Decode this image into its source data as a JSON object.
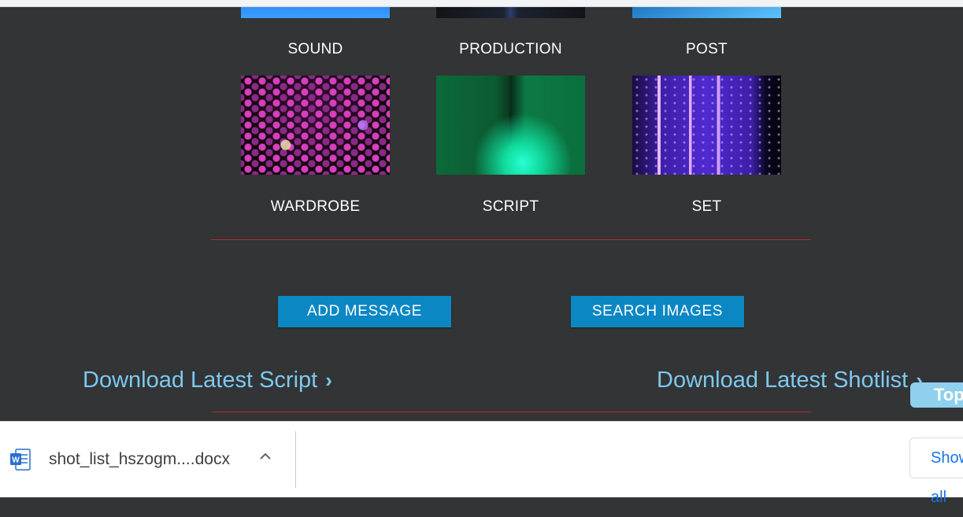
{
  "gallery": {
    "top_row": [
      {
        "label": "SOUND",
        "image": "blue-laser-photo"
      },
      {
        "label": "PRODUCTION",
        "image": "dark-stage-photo"
      },
      {
        "label": "POST",
        "image": "blue-light-beams-photo"
      }
    ],
    "bottom_row": [
      {
        "label": "WARDROBE",
        "image": "magenta-bokeh-photo"
      },
      {
        "label": "SCRIPT",
        "image": "green-light-photo"
      },
      {
        "label": "SET",
        "image": "purple-light-strips-photo"
      }
    ]
  },
  "actions": {
    "add_message": "ADD MESSAGE",
    "search_images": "SEARCH IMAGES"
  },
  "downloads": {
    "script_link": "Download Latest Script",
    "shotlist_link": "Download Latest Shotlist",
    "chevron": "›"
  },
  "top_button": "Top",
  "download_bar": {
    "file_name": "shot_list_hszogm....docx",
    "file_icon": "word-doc-icon",
    "show_all": "Show all"
  },
  "colors": {
    "page_bg": "#323435",
    "divider": "#b8283a",
    "button": "#0b87c4",
    "link": "#7ec8f0"
  }
}
